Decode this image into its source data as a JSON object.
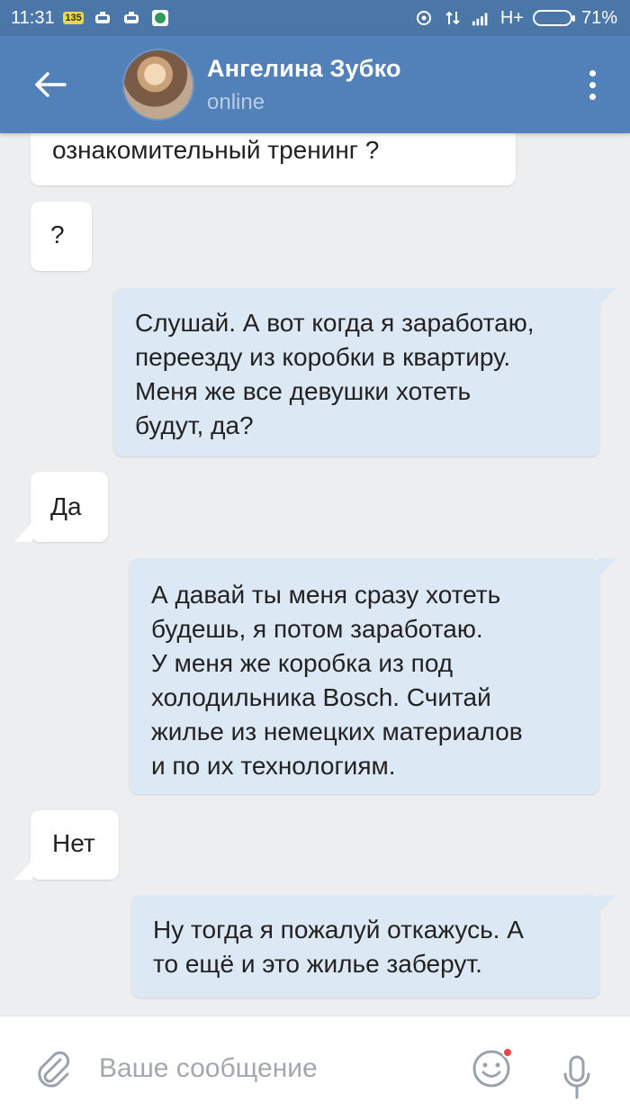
{
  "status_bar": {
    "time": "11:31",
    "notification_badge": "135",
    "network": "H+",
    "battery_level": 71,
    "battery_text": "71%"
  },
  "header": {
    "back_icon": "arrow-left-icon",
    "contact_name": "Ангелина Зубко",
    "contact_status": "online",
    "menu_icon": "more-vertical-icon"
  },
  "messages": [
    {
      "direction": "in",
      "text": "ознакомительный тренинг ?"
    },
    {
      "direction": "in",
      "text": "?"
    },
    {
      "direction": "out",
      "text": "Слушай. А вот когда я заработаю,\nпереезду из коробки в квартиру.\nМеня же все девушки хотеть\nбудут, да?"
    },
    {
      "direction": "in",
      "text": "Да"
    },
    {
      "direction": "out",
      "text": "А давай ты меня сразу хотеть\nбудешь, я потом заработаю.\nУ меня же коробка из под\nхолодильника Bosch. Считай\nжилье из немецких материалов\nи по их технологиям."
    },
    {
      "direction": "in",
      "text": "Нет"
    },
    {
      "direction": "out",
      "text": "Ну тогда я пожалуй откажусь. А\nто ещё и это жилье заберут."
    }
  ],
  "composer": {
    "attach_icon": "paperclip-icon",
    "placeholder": "Ваше сообщение",
    "emoji_icon": "smiley-icon",
    "mic_icon": "microphone-icon"
  },
  "colors": {
    "header_bg": "#5181b8",
    "status_bar_bg": "#4a76a8",
    "chat_bg": "#edeef0",
    "incoming_bubble": "#ffffff",
    "outgoing_bubble": "#dde8f5"
  }
}
